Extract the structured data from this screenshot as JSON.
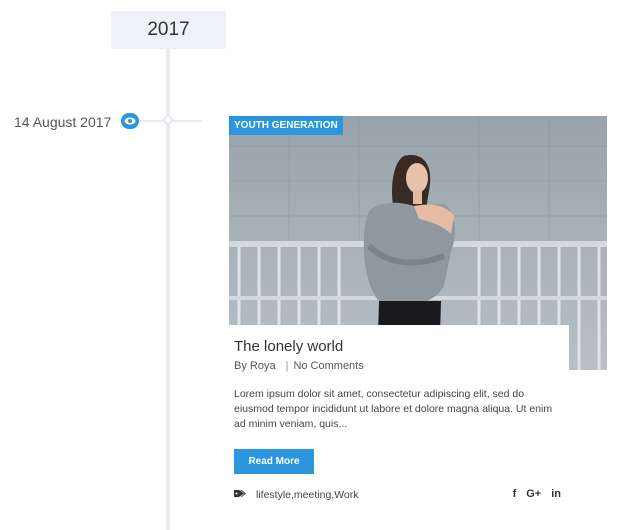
{
  "timeline": {
    "year": "2017"
  },
  "post": {
    "date": "14 August 2017",
    "category": "YOUTH GENERATION",
    "title": "The lonely world",
    "author": "By Roya",
    "comments": "No Comments",
    "excerpt": "Lorem ipsum dolor sit amet, consectetur adipiscing elit, sed do eiusmod tempor incididunt ut labore et dolore magna aliqua. Ut enim ad minim veniam, quis...",
    "read_more_label": "Read More",
    "tags": "lifestyle,meeting,Work",
    "social": {
      "facebook": "f",
      "googleplus": "G+",
      "linkedin": "in"
    }
  },
  "colors": {
    "accent": "#2996dd",
    "timeline": "#e8ebf0",
    "year_bg": "#eef1f6"
  },
  "icons": {
    "post_format": "eye-icon",
    "tags": "tag-icon"
  }
}
